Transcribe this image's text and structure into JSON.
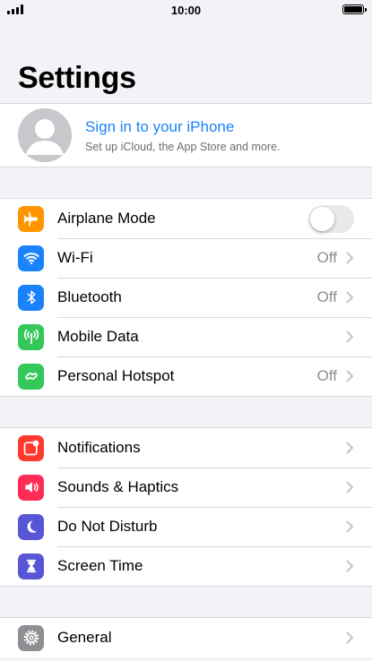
{
  "status_bar": {
    "time": "10:00"
  },
  "page_title": "Settings",
  "profile": {
    "title": "Sign in to your iPhone",
    "subtitle": "Set up iCloud, the App Store and more."
  },
  "groups": [
    {
      "items": [
        {
          "label": "Airplane Mode",
          "icon": "airplane-icon",
          "color": "#ff9500",
          "control": "toggle",
          "toggle_on": false
        },
        {
          "label": "Wi-Fi",
          "icon": "wifi-icon",
          "color": "#1a82fb",
          "value": "Off"
        },
        {
          "label": "Bluetooth",
          "icon": "bluetooth-icon",
          "color": "#1a82fb",
          "value": "Off"
        },
        {
          "label": "Mobile Data",
          "icon": "antenna-icon",
          "color": "#34c759",
          "value": ""
        },
        {
          "label": "Personal Hotspot",
          "icon": "hotspot-link-icon",
          "color": "#34c759",
          "value": "Off"
        }
      ]
    },
    {
      "items": [
        {
          "label": "Notifications",
          "icon": "notification-icon",
          "color": "#ff3b30",
          "value": ""
        },
        {
          "label": "Sounds & Haptics",
          "icon": "speaker-icon",
          "color": "#ff2d55",
          "value": ""
        },
        {
          "label": "Do Not Disturb",
          "icon": "moon-icon",
          "color": "#5856d6",
          "value": ""
        },
        {
          "label": "Screen Time",
          "icon": "hourglass-icon",
          "color": "#5856d6",
          "value": ""
        }
      ]
    },
    {
      "items": [
        {
          "label": "General",
          "icon": "gear-icon",
          "color": "#8e8e93",
          "value": ""
        }
      ]
    }
  ]
}
